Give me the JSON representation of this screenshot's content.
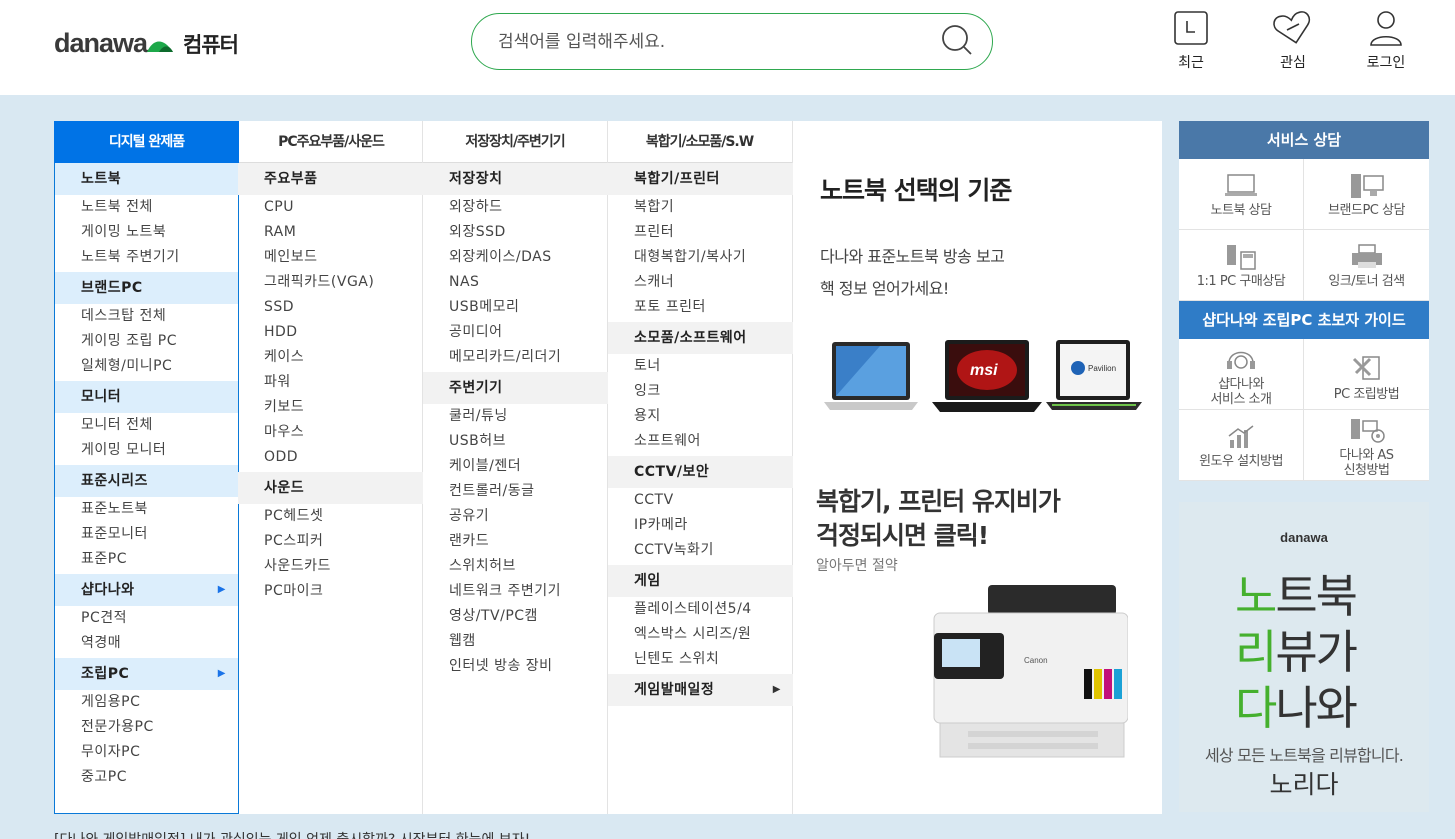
{
  "header": {
    "logo_text": "danawa",
    "category": "컴퓨터",
    "search_placeholder": "검색어를 입력해주세요.",
    "icons": [
      {
        "label": "최근",
        "icon": "recent-icon"
      },
      {
        "label": "관심",
        "icon": "heart-tag-icon"
      },
      {
        "label": "로그인",
        "icon": "user-icon"
      }
    ]
  },
  "tabs": [
    "디지털 완제품",
    "PC주요부품/사운드",
    "저장장치/주변기기",
    "복합기/소모품/S.W"
  ],
  "col1": {
    "g1": "노트북",
    "g1_items": [
      "노트북 전체",
      "게이밍 노트북",
      "노트북 주변기기"
    ],
    "g2": "브랜드PC",
    "g2_items": [
      "데스크탑 전체",
      "게이밍 조립 PC",
      "일체형/미니PC"
    ],
    "g3": "모니터",
    "g3_items": [
      "모니터 전체",
      "게이밍 모니터"
    ],
    "g4": "표준시리즈",
    "g4_items": [
      "표준노트북",
      "표준모니터",
      "표준PC"
    ],
    "g5": "샵다나와",
    "g5_items": [
      "PC견적",
      "역경매"
    ],
    "g6": "조립PC",
    "g6_items": [
      "게임용PC",
      "전문가용PC",
      "무이자PC",
      "중고PC"
    ]
  },
  "col2": {
    "g1": "주요부품",
    "g1_items": [
      "CPU",
      "RAM",
      "메인보드",
      "그래픽카드(VGA)",
      "SSD",
      "HDD",
      "케이스",
      "파워",
      "키보드",
      "마우스",
      "ODD"
    ],
    "g2": "사운드",
    "g2_items": [
      "PC헤드셋",
      "PC스피커",
      "사운드카드",
      "PC마이크"
    ]
  },
  "col3": {
    "g1": "저장장치",
    "g1_items": [
      "외장하드",
      "외장SSD",
      "외장케이스/DAS",
      "NAS",
      "USB메모리",
      "공미디어",
      "메모리카드/리더기"
    ],
    "g2": "주변기기",
    "g2_items": [
      "쿨러/튜닝",
      "USB허브",
      "케이블/젠더",
      "컨트롤러/동글",
      "공유기",
      "랜카드",
      "스위치허브",
      "네트워크 주변기기",
      "영상/TV/PC캠",
      "웹캠",
      "인터넷 방송 장비"
    ]
  },
  "col4": {
    "g1": "복합기/프린터",
    "g1_items": [
      "복합기",
      "프린터",
      "대형복합기/복사기",
      "스캐너",
      "포토 프린터"
    ],
    "g2": "소모품/소프트웨어",
    "g2_items": [
      "토너",
      "잉크",
      "용지",
      "소프트웨어"
    ],
    "g3": "CCTV/보안",
    "g3_items": [
      "CCTV",
      "IP카메라",
      "CCTV녹화기"
    ],
    "g4": "게임",
    "g4_items": [
      "플레이스테이션5/4",
      "엑스박스 시리즈/원",
      "닌텐도 스위치"
    ],
    "g5": "게임발매일정"
  },
  "promo": {
    "title": "노트북 선택의 기준",
    "sub1": "다나와 표준노트북 방송 보고",
    "sub2": "핵 정보 얻어가세요!",
    "brand_msi": "msi",
    "brand_hp": "Pavilion",
    "title2_line1": "복합기, 프린터 유지비가",
    "title2_line2": "걱정되시면 클릭!",
    "sub3": "알아두면 절약",
    "printer_brand": "Canon"
  },
  "service": {
    "title": "서비스 상담",
    "cells": [
      "노트북 상담",
      "브랜드PC 상담",
      "1:1 PC 구매상담",
      "잉크/토너 검색"
    ],
    "guide_title": "샵다나와 조립PC 초보자 가이드",
    "guide_cells": [
      "샵다나와",
      "서비스 소개",
      "PC 조립방법",
      "윈도우 설치방법",
      "다나와 AS",
      "신청방법"
    ]
  },
  "ad": {
    "logo": "danawa",
    "l1a": "노",
    "l1b": "트북",
    "l2a": "리",
    "l2b": "뷰가",
    "l3a": "다",
    "l3b": "나와",
    "tagline": "세상 모든 노트북을 리뷰합니다.",
    "brand": "노리다"
  },
  "ticker": "[다나와 게임발매일정] 내가 관심있는 게임 언제 출시할까? 시작부터 한눈에 보자!",
  "colors": {
    "accent": "#0073e6",
    "green": "#45b02e",
    "service_head": "#4a78a8",
    "guide_head": "#2f7cc7"
  }
}
